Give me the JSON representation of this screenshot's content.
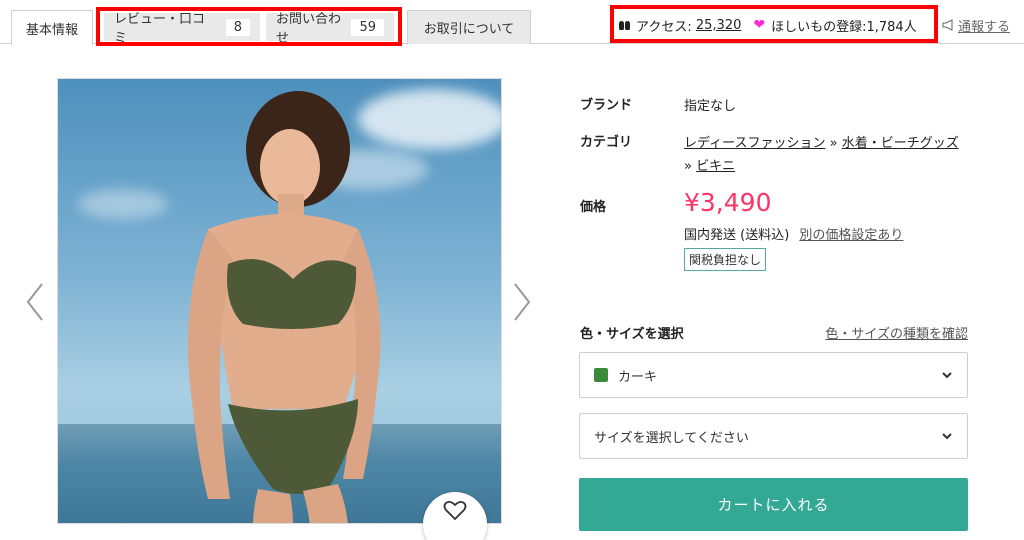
{
  "tabs": {
    "basic": "基本情報",
    "reviews": {
      "label": "レビュー・口コミ",
      "count": "8"
    },
    "inquiries": {
      "label": "お問い合わせ",
      "count": "59"
    },
    "trade": "お取引について"
  },
  "stats": {
    "access_label": "アクセス:",
    "access_count": "25,320",
    "wishlist_text": "ほしいもの登録:1,784人",
    "report_label": "通報する"
  },
  "product": {
    "brand_label": "ブランド",
    "brand_value": "指定なし",
    "category_label": "カテゴリ",
    "category_1": "レディースファッション",
    "category_sep": "»",
    "category_2": "水着・ビーチグッズ",
    "category_3": "ビキニ",
    "price_label": "価格",
    "price": "¥3,490",
    "shipping": "国内発送 (送料込)",
    "other_price_link": "別の価格設定あり",
    "duty_badge": "関税負担なし"
  },
  "selection": {
    "title": "色・サイズを選択",
    "types_link": "色・サイズの種類を確認",
    "color_value": "カーキ",
    "size_placeholder": "サイズを選択してください"
  },
  "cart_button": "カートに入れる",
  "colors": {
    "price": "#ff3366",
    "cart": "#33a895",
    "swatch_khaki": "#3a8a3a",
    "highlight_box": "#ff0000",
    "heart": "#ff2bd6"
  },
  "icons": [
    "footprints-icon",
    "heart-icon",
    "megaphone-icon",
    "chevron-left-icon",
    "chevron-right-icon",
    "favorite-heart-icon",
    "chevron-down-icon"
  ]
}
